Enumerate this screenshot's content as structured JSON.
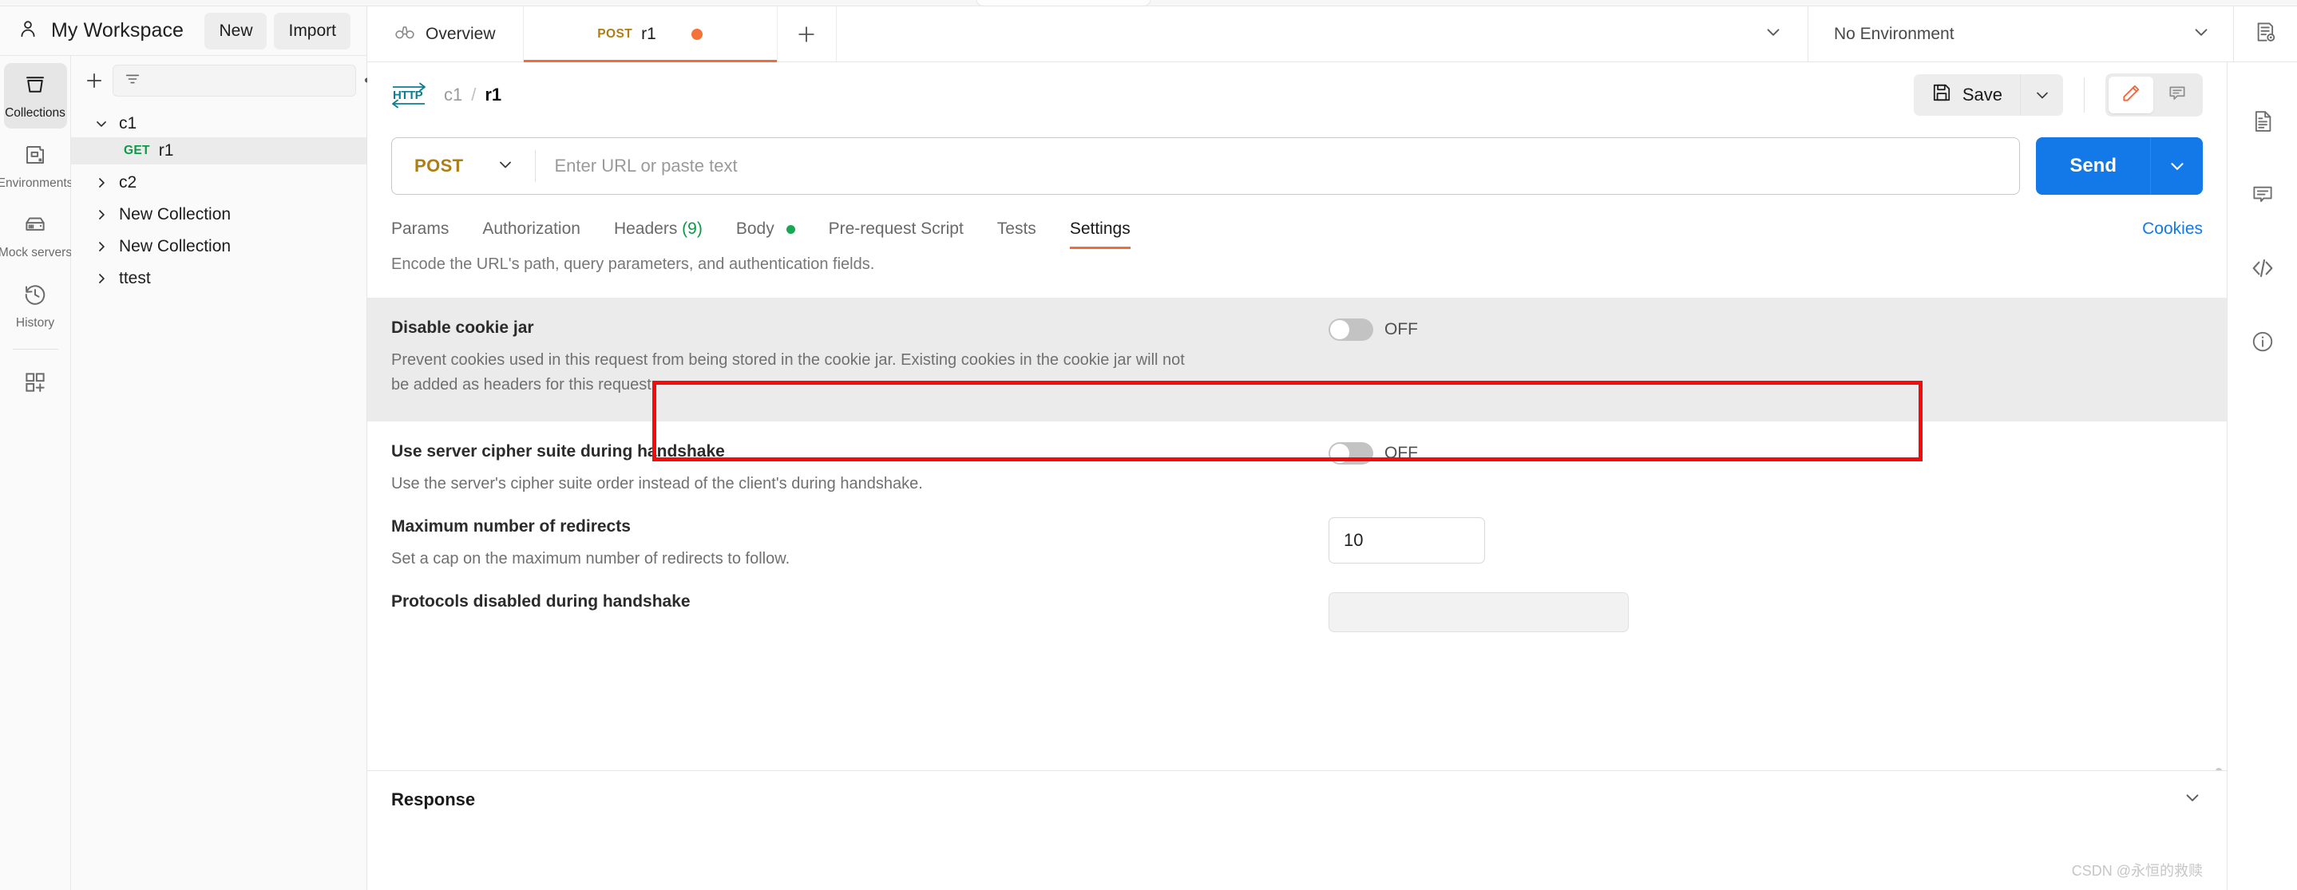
{
  "workspace": {
    "title": "My Workspace",
    "new_button": "New",
    "import_button": "Import"
  },
  "rail": {
    "items": [
      {
        "label": "Collections",
        "icon": "collections-icon",
        "active": true
      },
      {
        "label": "Environments",
        "icon": "environments-icon",
        "active": false
      },
      {
        "label": "Mock servers",
        "icon": "mock-servers-icon",
        "active": false
      },
      {
        "label": "History",
        "icon": "history-icon",
        "active": false
      }
    ],
    "more_icon": "apps-grid-plus-icon"
  },
  "sidebar": {
    "filter_placeholder": "",
    "tree": [
      {
        "name": "c1",
        "expanded": true,
        "selected": false
      },
      {
        "name": "r1",
        "method": "GET",
        "child": true,
        "selected": true
      },
      {
        "name": "c2",
        "expanded": false,
        "selected": false
      },
      {
        "name": "New Collection",
        "expanded": false,
        "selected": false
      },
      {
        "name": "New Collection",
        "expanded": false,
        "selected": false
      },
      {
        "name": "ttest",
        "expanded": false,
        "selected": false
      }
    ]
  },
  "tabs": {
    "overview": "Overview",
    "request": {
      "method": "POST",
      "name": "r1",
      "unsaved": true
    },
    "add_label": "+",
    "environment": {
      "value": "No Environment"
    }
  },
  "breadcrumb": {
    "protocol": "HTTP",
    "collection": "c1",
    "separator": "/",
    "request": "r1"
  },
  "actions": {
    "save_label": "Save",
    "edit_icon": "pencil-icon",
    "comment_icon": "comment-icon"
  },
  "url_bar": {
    "method": "POST",
    "url_value": "",
    "url_placeholder": "Enter URL or paste text",
    "send_label": "Send"
  },
  "request_tabs": {
    "items": [
      {
        "label": "Params",
        "active": false
      },
      {
        "label": "Authorization",
        "active": false
      },
      {
        "label": "Headers",
        "count": "(9)",
        "active": false
      },
      {
        "label": "Body",
        "dot": true,
        "active": false
      },
      {
        "label": "Pre-request Script",
        "active": false
      },
      {
        "label": "Tests",
        "active": false
      },
      {
        "label": "Settings",
        "active": true
      }
    ],
    "cookies_link": "Cookies"
  },
  "settings": {
    "encode_description": "Encode the URL's path, query parameters, and authentication fields.",
    "rows": [
      {
        "title": "Disable cookie jar",
        "description": "Prevent cookies used in this request from being stored in the cookie jar. Existing cookies in the cookie jar will not be added as headers for this request.",
        "control": "toggle",
        "toggle_state": "OFF",
        "highlighted": true
      },
      {
        "title": "Use server cipher suite during handshake",
        "description": "Use the server's cipher suite order instead of the client's during handshake.",
        "control": "toggle",
        "toggle_state": "OFF",
        "highlighted": false
      },
      {
        "title": "Maximum number of redirects",
        "description": "Set a cap on the maximum number of redirects to follow.",
        "control": "number",
        "value": "10",
        "highlighted": false
      },
      {
        "title": "Protocols disabled during handshake",
        "description": "",
        "control": "box",
        "highlighted": false
      }
    ]
  },
  "response": {
    "title": "Response"
  },
  "right_rail": {
    "icons": [
      "document-icon",
      "comment-icon",
      "code-icon",
      "info-icon"
    ]
  },
  "watermark": "CSDN @永恒的救赎",
  "colors": {
    "accent_orange": "#f26b3a",
    "send_blue": "#1379e8",
    "get_green": "#0a9b44",
    "post_gold": "#b07c14",
    "highlight_red": "#f50b0b"
  }
}
